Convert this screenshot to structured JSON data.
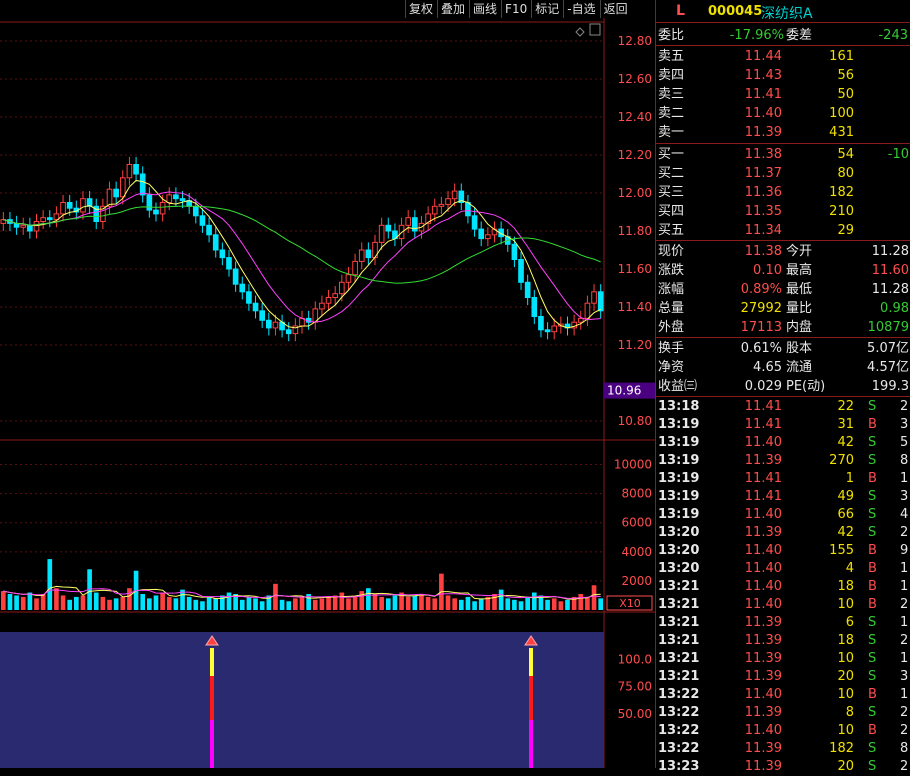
{
  "toolbar": [
    "复权",
    "叠加",
    "画线",
    "F10",
    "标记",
    "-自选",
    "返回"
  ],
  "stock": {
    "marker": "L",
    "code": "000045",
    "name": "深纺织A"
  },
  "weibi": {
    "label1": "委比",
    "val1": "-17.96%",
    "label2": "委差",
    "val2": "-243"
  },
  "asks": [
    {
      "label": "卖五",
      "price": "11.44",
      "vol": "161"
    },
    {
      "label": "卖四",
      "price": "11.43",
      "vol": "56"
    },
    {
      "label": "卖三",
      "price": "11.41",
      "vol": "50"
    },
    {
      "label": "卖二",
      "price": "11.40",
      "vol": "100"
    },
    {
      "label": "卖一",
      "price": "11.39",
      "vol": "431"
    }
  ],
  "bids": [
    {
      "label": "买一",
      "price": "11.38",
      "vol": "54",
      "chg": "-10"
    },
    {
      "label": "买二",
      "price": "11.37",
      "vol": "80",
      "chg": ""
    },
    {
      "label": "买三",
      "price": "11.36",
      "vol": "182",
      "chg": ""
    },
    {
      "label": "买四",
      "price": "11.35",
      "vol": "210",
      "chg": ""
    },
    {
      "label": "买五",
      "price": "11.34",
      "vol": "29",
      "chg": ""
    }
  ],
  "quote": [
    {
      "l1": "现价",
      "v1": "11.38",
      "l2": "今开",
      "v2": "11.28",
      "c1": "red",
      "c2": "wht"
    },
    {
      "l1": "涨跌",
      "v1": "0.10",
      "l2": "最高",
      "v2": "11.60",
      "c1": "red",
      "c2": "red"
    },
    {
      "l1": "涨幅",
      "v1": "0.89%",
      "l2": "最低",
      "v2": "11.28",
      "c1": "red",
      "c2": "wht"
    },
    {
      "l1": "总量",
      "v1": "27992",
      "l2": "量比",
      "v2": "0.98",
      "c1": "yel",
      "c2": "grn"
    },
    {
      "l1": "外盘",
      "v1": "17113",
      "l2": "内盘",
      "v2": "10879",
      "c1": "red",
      "c2": "grn"
    }
  ],
  "fin": [
    {
      "l1": "换手",
      "v1": "0.61%",
      "l2": "股本",
      "v2": "5.07亿"
    },
    {
      "l1": "净资",
      "v1": "4.65",
      "l2": "流通",
      "v2": "4.57亿"
    },
    {
      "l1": "收益㈢",
      "v1": "0.029",
      "l2": "PE(动)",
      "v2": "199.3"
    }
  ],
  "ticks": [
    {
      "t": "13:18",
      "p": "11.41",
      "v": "22",
      "bs": "S",
      "n": "2"
    },
    {
      "t": "13:19",
      "p": "11.41",
      "v": "31",
      "bs": "B",
      "n": "3"
    },
    {
      "t": "13:19",
      "p": "11.40",
      "v": "42",
      "bs": "S",
      "n": "5"
    },
    {
      "t": "13:19",
      "p": "11.39",
      "v": "270",
      "bs": "S",
      "n": "8"
    },
    {
      "t": "13:19",
      "p": "11.41",
      "v": "1",
      "bs": "B",
      "n": "1"
    },
    {
      "t": "13:19",
      "p": "11.41",
      "v": "49",
      "bs": "S",
      "n": "3"
    },
    {
      "t": "13:19",
      "p": "11.40",
      "v": "66",
      "bs": "S",
      "n": "4"
    },
    {
      "t": "13:20",
      "p": "11.39",
      "v": "42",
      "bs": "S",
      "n": "2"
    },
    {
      "t": "13:20",
      "p": "11.40",
      "v": "155",
      "bs": "B",
      "n": "9"
    },
    {
      "t": "13:20",
      "p": "11.40",
      "v": "4",
      "bs": "B",
      "n": "1"
    },
    {
      "t": "13:21",
      "p": "11.40",
      "v": "18",
      "bs": "B",
      "n": "1"
    },
    {
      "t": "13:21",
      "p": "11.40",
      "v": "10",
      "bs": "B",
      "n": "2"
    },
    {
      "t": "13:21",
      "p": "11.39",
      "v": "6",
      "bs": "S",
      "n": "1"
    },
    {
      "t": "13:21",
      "p": "11.39",
      "v": "18",
      "bs": "S",
      "n": "2"
    },
    {
      "t": "13:21",
      "p": "11.39",
      "v": "10",
      "bs": "S",
      "n": "1"
    },
    {
      "t": "13:21",
      "p": "11.39",
      "v": "20",
      "bs": "S",
      "n": "3"
    },
    {
      "t": "13:22",
      "p": "11.40",
      "v": "10",
      "bs": "B",
      "n": "1"
    },
    {
      "t": "13:22",
      "p": "11.39",
      "v": "8",
      "bs": "S",
      "n": "2"
    },
    {
      "t": "13:22",
      "p": "11.40",
      "v": "10",
      "bs": "B",
      "n": "2"
    },
    {
      "t": "13:22",
      "p": "11.39",
      "v": "182",
      "bs": "S",
      "n": "8"
    },
    {
      "t": "13:23",
      "p": "11.39",
      "v": "20",
      "bs": "S",
      "n": "2"
    }
  ],
  "chart_data": {
    "type": "line",
    "price_axis": [
      "12.80",
      "12.60",
      "12.40",
      "12.20",
      "12.00",
      "11.80",
      "11.60",
      "11.40",
      "11.20",
      "10.80"
    ],
    "price_ylim": [
      10.7,
      12.9
    ],
    "price_marker": "10.96",
    "volume_axis": [
      "10000",
      "8000",
      "6000",
      "4000",
      "2000"
    ],
    "volume_unit": "X10",
    "indicator_axis": [
      "100.0",
      "75.00",
      "50.00"
    ],
    "closes": [
      11.86,
      11.84,
      11.82,
      11.83,
      11.8,
      11.85,
      11.87,
      11.86,
      11.89,
      11.95,
      11.92,
      11.9,
      11.97,
      11.93,
      11.85,
      11.93,
      12.02,
      11.98,
      12.08,
      12.15,
      12.1,
      11.99,
      11.91,
      11.89,
      11.95,
      11.99,
      11.97,
      11.96,
      11.93,
      11.88,
      11.83,
      11.78,
      11.7,
      11.66,
      11.6,
      11.52,
      11.48,
      11.42,
      11.38,
      11.33,
      11.29,
      11.32,
      11.28,
      11.26,
      11.3,
      11.34,
      11.32,
      11.39,
      11.42,
      11.45,
      11.47,
      11.53,
      11.57,
      11.64,
      11.7,
      11.66,
      11.74,
      11.83,
      11.8,
      11.76,
      11.83,
      11.87,
      11.8,
      11.84,
      11.89,
      11.93,
      11.94,
      11.97,
      12.01,
      11.95,
      11.88,
      11.81,
      11.76,
      11.78,
      11.81,
      11.77,
      11.73,
      11.65,
      11.53,
      11.45,
      11.35,
      11.28,
      11.27,
      11.3,
      11.31,
      11.29,
      11.32,
      11.34,
      11.42,
      11.48,
      11.38
    ],
    "volumes": [
      1300,
      1100,
      1000,
      900,
      1200,
      800,
      1100,
      3500,
      1500,
      1000,
      700,
      900,
      1000,
      2800,
      1200,
      900,
      700,
      800,
      900,
      1500,
      2700,
      1100,
      800,
      1000,
      1200,
      900,
      800,
      1400,
      900,
      700,
      600,
      900,
      800,
      1000,
      1200,
      1100,
      700,
      900,
      800,
      600,
      1000,
      1800,
      700,
      600,
      800,
      900,
      1100,
      700,
      800,
      900,
      1000,
      1200,
      800,
      900,
      1300,
      1500,
      1100,
      900,
      800,
      1000,
      1200,
      900,
      1000,
      1100,
      900,
      800,
      2500,
      1000,
      800,
      700,
      900,
      600,
      800,
      900,
      1100,
      1400,
      800,
      700,
      600,
      900,
      1200,
      1000,
      700,
      800,
      600,
      700,
      900,
      1100,
      900,
      1700,
      800
    ],
    "arrow_markers": [
      "100.0",
      "100.0"
    ]
  }
}
